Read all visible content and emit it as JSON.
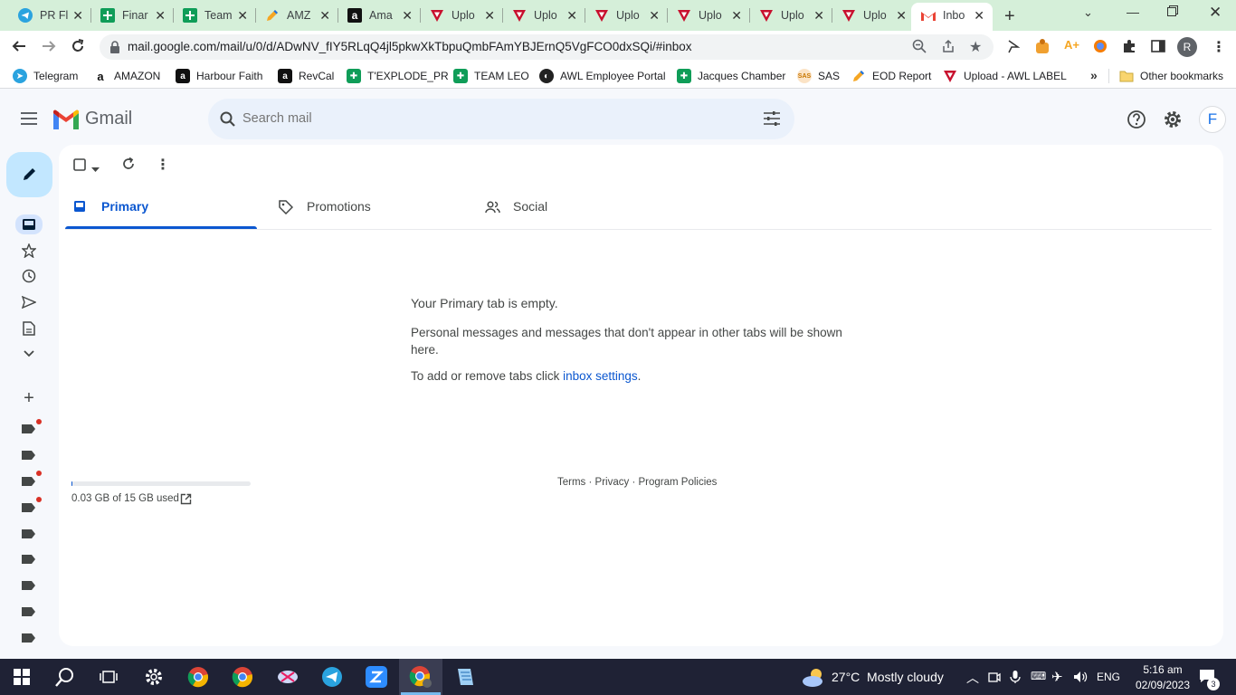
{
  "browser": {
    "tabs": [
      {
        "title": "PR Fl",
        "icon": "telegram-icon"
      },
      {
        "title": "Finar",
        "icon": "sheets-icon"
      },
      {
        "title": "Team",
        "icon": "sheets-icon"
      },
      {
        "title": "AMZ",
        "icon": "pencil-icon"
      },
      {
        "title": "Ama",
        "icon": "amazon-icon"
      },
      {
        "title": "Uplo",
        "icon": "awl-icon"
      },
      {
        "title": "Uplo",
        "icon": "awl-icon"
      },
      {
        "title": "Uplo",
        "icon": "awl-icon"
      },
      {
        "title": "Uplo",
        "icon": "awl-icon"
      },
      {
        "title": "Uplo",
        "icon": "awl-icon"
      },
      {
        "title": "Uplo",
        "icon": "awl-icon"
      },
      {
        "title": "Inbo",
        "icon": "gmail-icon",
        "active": true
      }
    ],
    "url": "mail.google.com/mail/u/0/d/ADwNV_fIY5RLqQ4jl5pkwXkTbpuQmbFAmYBJErnQ5VgFCO0dxSQi/#inbox",
    "profile_initial": "R",
    "bookmarks": [
      {
        "label": "Telegram",
        "icon": "telegram-icon"
      },
      {
        "label": "AMAZON",
        "icon": "amazon-icon"
      },
      {
        "label": "Harbour Faith",
        "icon": "amazon-icon"
      },
      {
        "label": "RevCal",
        "icon": "amazon-icon"
      },
      {
        "label": "T'EXPLODE_PR",
        "icon": "sheets-icon"
      },
      {
        "label": "TEAM LEO",
        "icon": "sheets-icon"
      },
      {
        "label": "AWL Employee Portal",
        "icon": "globe-icon"
      },
      {
        "label": "Jacques Chamber",
        "icon": "sheets-icon"
      },
      {
        "label": "SAS",
        "icon": "sas-icon"
      },
      {
        "label": "EOD Report",
        "icon": "pencil-icon"
      },
      {
        "label": "Upload - AWL LABEL",
        "icon": "awl-icon"
      }
    ],
    "other_bookmarks": "Other bookmarks"
  },
  "gmail": {
    "logo_text": "Gmail",
    "search_placeholder": "Search mail",
    "account_initial": "F",
    "tabs": [
      {
        "label": "Primary",
        "active": true
      },
      {
        "label": "Promotions"
      },
      {
        "label": "Social"
      }
    ],
    "empty": {
      "title": "Your Primary tab is empty.",
      "desc": "Personal messages and messages that don't appear in other tabs will be shown here.",
      "tabs_prefix": "To add or remove tabs click ",
      "tabs_link": "inbox settings",
      "tabs_suffix": "."
    },
    "storage": {
      "text": "0.03 GB of 15 GB used",
      "used_fraction": 0.002
    },
    "footer": {
      "terms": "Terms",
      "privacy": "Privacy",
      "policies": "Program Policies",
      "sep": " · "
    }
  },
  "taskbar": {
    "weather": "27°C  Mostly cloudy",
    "lang": "ENG",
    "time": "5:16 am",
    "date": "02/09/2023",
    "notifications": "3"
  },
  "colors": {
    "accent": "#0b57d0",
    "tab_strip": "#d5efd9",
    "taskbar": "#1f2235",
    "label_dot": "#d93025"
  }
}
